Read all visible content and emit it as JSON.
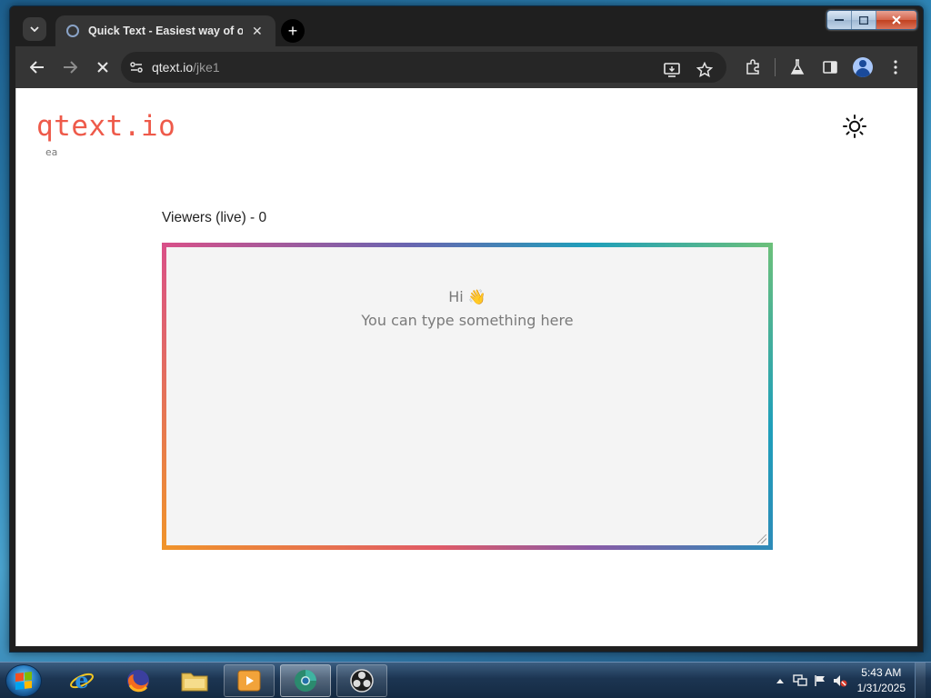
{
  "browser": {
    "tab": {
      "title": "Quick Text - Easiest way of onl",
      "close_label": "✕"
    },
    "new_tab_label": "+",
    "address": {
      "domain": "qtext.io",
      "path": "/jke1"
    }
  },
  "page": {
    "logo": "qtext.io",
    "logo_sub": "ea",
    "viewers_label": "Viewers (live) - 0",
    "editor": {
      "placeholder_line1": "Hi 👋",
      "placeholder_line2": "You can type something here",
      "border_colors": [
        "#d95088",
        "#6a64b0",
        "#1f9fba",
        "#6cc07a",
        "#f0942a"
      ]
    },
    "logo_color": "#ee5a4a"
  },
  "taskbar": {
    "apps": [
      {
        "name": "internet-explorer-icon"
      },
      {
        "name": "firefox-icon"
      },
      {
        "name": "file-explorer-icon"
      },
      {
        "name": "media-player-icon"
      },
      {
        "name": "chrome-icon"
      },
      {
        "name": "obs-icon"
      }
    ],
    "clock": {
      "time": "5:43 AM",
      "date": "1/31/2025"
    }
  }
}
